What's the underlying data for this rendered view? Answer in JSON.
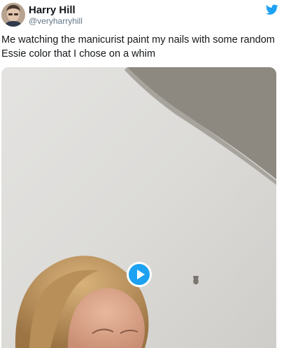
{
  "author": {
    "display_name": "Harry Hill",
    "handle": "@veryharryhill"
  },
  "tweet": {
    "text_line_1": "Me watching the manicurist paint my nails with some random",
    "text_line_2": "Essie color that I chose on a whim"
  },
  "icons": {
    "brand": "twitter-bird-icon",
    "media_control": "play-icon"
  },
  "colors": {
    "brand_blue": "#1da1f2",
    "name": "#14171a",
    "handle": "#657786"
  }
}
